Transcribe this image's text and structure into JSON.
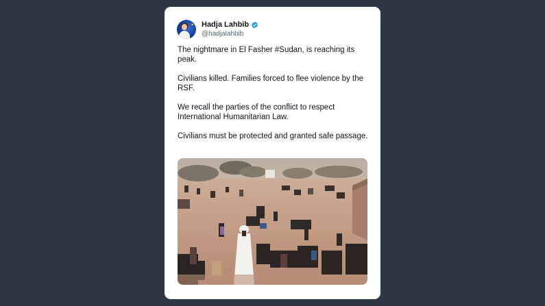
{
  "author": {
    "display_name": "Hadja Lahbib",
    "handle": "@hadjalahbib",
    "verified": true
  },
  "tweet": {
    "paragraphs": [
      "The nightmare in El Fasher #Sudan, is reaching its peak.",
      "Civilians killed. Families forced to flee violence by the RSF.",
      "We recall the parties of the conflict to respect International Humanitarian Law.",
      "Civilians must be protected and granted safe passage."
    ]
  },
  "colors": {
    "page_background": "#2e3643",
    "card_background": "#ffffff",
    "text_primary": "#0f1419",
    "text_secondary": "#536471",
    "verified_badge": "#1d9bf0"
  },
  "icons": {
    "verified": "verified-badge-icon",
    "avatar": "profile-avatar"
  }
}
